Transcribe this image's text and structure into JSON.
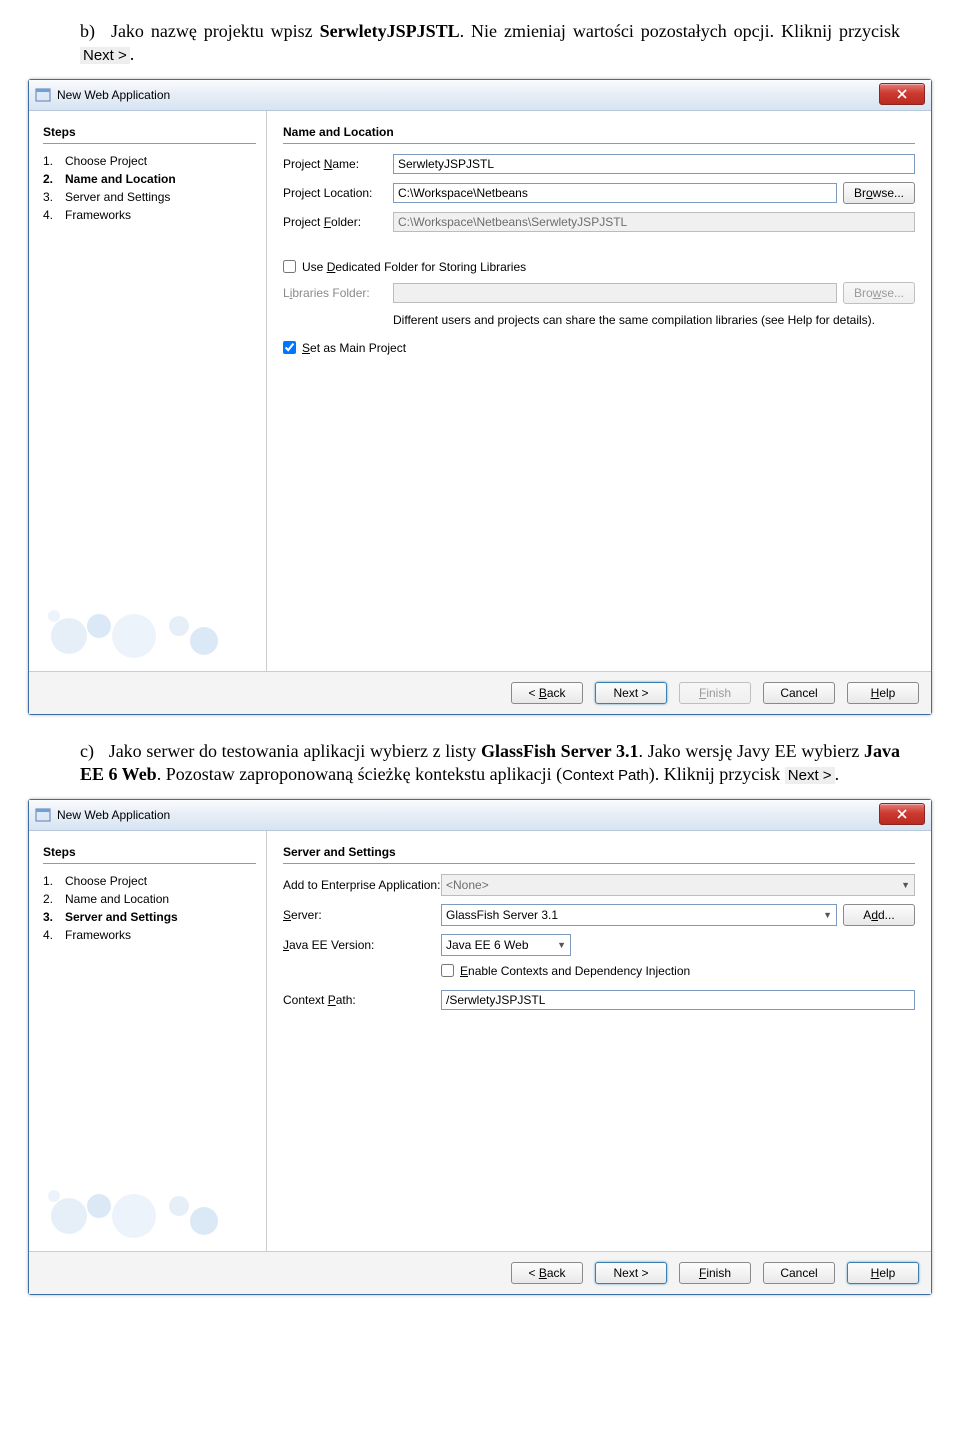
{
  "instructions": {
    "b_marker": "b)",
    "b_text_1": "Jako nazwę projektu wpisz ",
    "b_bold_1": "SerwletyJSPJSTL",
    "b_text_2": ". Nie zmieniaj wartości pozostałych opcji. Kliknij przycisk ",
    "b_btn": "Next >",
    "b_text_3": ".",
    "c_marker": "c)",
    "c_text_1": "Jako serwer do testowania aplikacji wybierz z listy ",
    "c_bold_1": "GlassFish Server 3.1",
    "c_text_2": ". Jako wersję Javy EE wybierz ",
    "c_bold_2": "Java EE 6 Web",
    "c_text_3": ". Pozostaw zaproponowaną ścieżkę kontekstu aplikacji (",
    "c_sans": "Context Path",
    "c_text_4": "). Kliknij przycisk ",
    "c_btn": "Next >",
    "c_text_5": "."
  },
  "dialog1": {
    "title": "New Web Application",
    "steps_title": "Steps",
    "steps": [
      {
        "num": "1.",
        "label": "Choose Project",
        "active": false
      },
      {
        "num": "2.",
        "label": "Name and Location",
        "active": true
      },
      {
        "num": "3.",
        "label": "Server and Settings",
        "active": false
      },
      {
        "num": "4.",
        "label": "Frameworks",
        "active": false
      }
    ],
    "main_title": "Name and Location",
    "project_name_label": "Project Name:",
    "project_name_value": "SerwletyJSPJSTL",
    "project_location_label": "Project Location:",
    "project_location_value": "C:\\Workspace\\Netbeans",
    "browse1": "Browse...",
    "project_folder_label": "Project Folder:",
    "project_folder_value": "C:\\Workspace\\Netbeans\\SerwletyJSPJSTL",
    "dedicated_cb": "Use Dedicated Folder for Storing Libraries",
    "libraries_folder_label": "Libraries Folder:",
    "browse2": "Browse...",
    "note": "Different users and projects can share the same compilation libraries (see Help for details).",
    "set_main_cb": "Set as Main Project",
    "buttons": {
      "back": "< Back",
      "next": "Next >",
      "finish": "Finish",
      "cancel": "Cancel",
      "help": "Help"
    }
  },
  "dialog2": {
    "title": "New Web Application",
    "steps_title": "Steps",
    "steps": [
      {
        "num": "1.",
        "label": "Choose Project",
        "active": false
      },
      {
        "num": "2.",
        "label": "Name and Location",
        "active": false
      },
      {
        "num": "3.",
        "label": "Server and Settings",
        "active": true
      },
      {
        "num": "4.",
        "label": "Frameworks",
        "active": false
      }
    ],
    "main_title": "Server and Settings",
    "add_ent_label": "Add to Enterprise Application:",
    "add_ent_value": "<None>",
    "server_label": "Server:",
    "server_value": "GlassFish Server 3.1",
    "add_btn": "Add...",
    "javaee_label": "Java EE Version:",
    "javaee_value": "Java EE 6 Web",
    "enable_cdi": "Enable Contexts and Dependency Injection",
    "context_path_label": "Context Path:",
    "context_path_value": "/SerwletyJSPJSTL",
    "buttons": {
      "back": "< Back",
      "next": "Next >",
      "finish": "Finish",
      "cancel": "Cancel",
      "help": "Help"
    }
  }
}
